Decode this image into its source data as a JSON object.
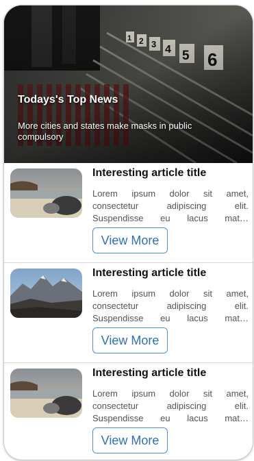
{
  "hero": {
    "title": "Todays's Top News",
    "subtitle": "More cities and states make masks in public compulsory",
    "numbers": [
      "1",
      "2",
      "3",
      "4",
      "5",
      "6"
    ]
  },
  "articles": [
    {
      "title": "Interesting article title",
      "text_line1": "Lorem ipsum dolor sit amet,",
      "text_line2": "consectetur adipiscing elit.",
      "text_line3": "Suspendisse eu lacus mat…",
      "button": "View More",
      "image": "beach-rocks"
    },
    {
      "title": "Interesting article title",
      "text_line1": "Lorem ipsum dolor sit amet,",
      "text_line2": "consectetur adipiscing elit.",
      "text_line3": "Suspendisse eu lacus mat…",
      "button": "View More",
      "image": "mountains"
    },
    {
      "title": "Interesting article title",
      "text_line1": "Lorem ipsum dolor sit amet,",
      "text_line2": "consectetur adipiscing elit.",
      "text_line3": "Suspendisse eu lacus mat…",
      "button": "View More",
      "image": "beach-rocks"
    }
  ],
  "colors": {
    "button_border": "#4a90d9",
    "button_text": "#2f6fb7"
  }
}
